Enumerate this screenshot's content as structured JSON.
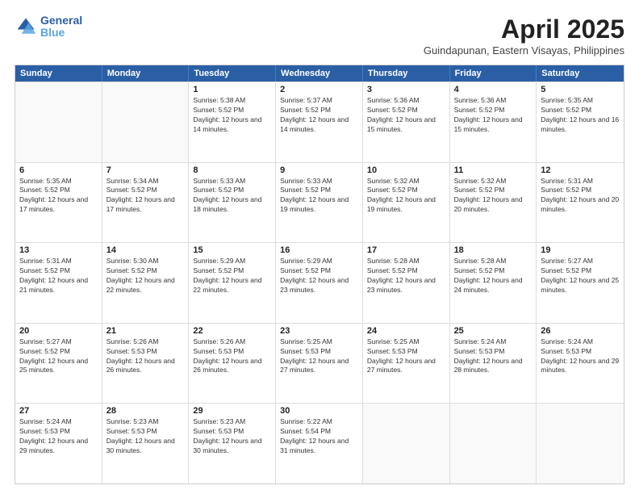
{
  "header": {
    "logo_line1": "General",
    "logo_line2": "Blue",
    "month": "April 2025",
    "location": "Guindapunan, Eastern Visayas, Philippines"
  },
  "weekdays": [
    "Sunday",
    "Monday",
    "Tuesday",
    "Wednesday",
    "Thursday",
    "Friday",
    "Saturday"
  ],
  "weeks": [
    [
      {
        "day": "",
        "sunrise": "",
        "sunset": "",
        "daylight": ""
      },
      {
        "day": "",
        "sunrise": "",
        "sunset": "",
        "daylight": ""
      },
      {
        "day": "1",
        "sunrise": "Sunrise: 5:38 AM",
        "sunset": "Sunset: 5:52 PM",
        "daylight": "Daylight: 12 hours and 14 minutes."
      },
      {
        "day": "2",
        "sunrise": "Sunrise: 5:37 AM",
        "sunset": "Sunset: 5:52 PM",
        "daylight": "Daylight: 12 hours and 14 minutes."
      },
      {
        "day": "3",
        "sunrise": "Sunrise: 5:36 AM",
        "sunset": "Sunset: 5:52 PM",
        "daylight": "Daylight: 12 hours and 15 minutes."
      },
      {
        "day": "4",
        "sunrise": "Sunrise: 5:36 AM",
        "sunset": "Sunset: 5:52 PM",
        "daylight": "Daylight: 12 hours and 15 minutes."
      },
      {
        "day": "5",
        "sunrise": "Sunrise: 5:35 AM",
        "sunset": "Sunset: 5:52 PM",
        "daylight": "Daylight: 12 hours and 16 minutes."
      }
    ],
    [
      {
        "day": "6",
        "sunrise": "Sunrise: 5:35 AM",
        "sunset": "Sunset: 5:52 PM",
        "daylight": "Daylight: 12 hours and 17 minutes."
      },
      {
        "day": "7",
        "sunrise": "Sunrise: 5:34 AM",
        "sunset": "Sunset: 5:52 PM",
        "daylight": "Daylight: 12 hours and 17 minutes."
      },
      {
        "day": "8",
        "sunrise": "Sunrise: 5:33 AM",
        "sunset": "Sunset: 5:52 PM",
        "daylight": "Daylight: 12 hours and 18 minutes."
      },
      {
        "day": "9",
        "sunrise": "Sunrise: 5:33 AM",
        "sunset": "Sunset: 5:52 PM",
        "daylight": "Daylight: 12 hours and 19 minutes."
      },
      {
        "day": "10",
        "sunrise": "Sunrise: 5:32 AM",
        "sunset": "Sunset: 5:52 PM",
        "daylight": "Daylight: 12 hours and 19 minutes."
      },
      {
        "day": "11",
        "sunrise": "Sunrise: 5:32 AM",
        "sunset": "Sunset: 5:52 PM",
        "daylight": "Daylight: 12 hours and 20 minutes."
      },
      {
        "day": "12",
        "sunrise": "Sunrise: 5:31 AM",
        "sunset": "Sunset: 5:52 PM",
        "daylight": "Daylight: 12 hours and 20 minutes."
      }
    ],
    [
      {
        "day": "13",
        "sunrise": "Sunrise: 5:31 AM",
        "sunset": "Sunset: 5:52 PM",
        "daylight": "Daylight: 12 hours and 21 minutes."
      },
      {
        "day": "14",
        "sunrise": "Sunrise: 5:30 AM",
        "sunset": "Sunset: 5:52 PM",
        "daylight": "Daylight: 12 hours and 22 minutes."
      },
      {
        "day": "15",
        "sunrise": "Sunrise: 5:29 AM",
        "sunset": "Sunset: 5:52 PM",
        "daylight": "Daylight: 12 hours and 22 minutes."
      },
      {
        "day": "16",
        "sunrise": "Sunrise: 5:29 AM",
        "sunset": "Sunset: 5:52 PM",
        "daylight": "Daylight: 12 hours and 23 minutes."
      },
      {
        "day": "17",
        "sunrise": "Sunrise: 5:28 AM",
        "sunset": "Sunset: 5:52 PM",
        "daylight": "Daylight: 12 hours and 23 minutes."
      },
      {
        "day": "18",
        "sunrise": "Sunrise: 5:28 AM",
        "sunset": "Sunset: 5:52 PM",
        "daylight": "Daylight: 12 hours and 24 minutes."
      },
      {
        "day": "19",
        "sunrise": "Sunrise: 5:27 AM",
        "sunset": "Sunset: 5:52 PM",
        "daylight": "Daylight: 12 hours and 25 minutes."
      }
    ],
    [
      {
        "day": "20",
        "sunrise": "Sunrise: 5:27 AM",
        "sunset": "Sunset: 5:52 PM",
        "daylight": "Daylight: 12 hours and 25 minutes."
      },
      {
        "day": "21",
        "sunrise": "Sunrise: 5:26 AM",
        "sunset": "Sunset: 5:53 PM",
        "daylight": "Daylight: 12 hours and 26 minutes."
      },
      {
        "day": "22",
        "sunrise": "Sunrise: 5:26 AM",
        "sunset": "Sunset: 5:53 PM",
        "daylight": "Daylight: 12 hours and 26 minutes."
      },
      {
        "day": "23",
        "sunrise": "Sunrise: 5:25 AM",
        "sunset": "Sunset: 5:53 PM",
        "daylight": "Daylight: 12 hours and 27 minutes."
      },
      {
        "day": "24",
        "sunrise": "Sunrise: 5:25 AM",
        "sunset": "Sunset: 5:53 PM",
        "daylight": "Daylight: 12 hours and 27 minutes."
      },
      {
        "day": "25",
        "sunrise": "Sunrise: 5:24 AM",
        "sunset": "Sunset: 5:53 PM",
        "daylight": "Daylight: 12 hours and 28 minutes."
      },
      {
        "day": "26",
        "sunrise": "Sunrise: 5:24 AM",
        "sunset": "Sunset: 5:53 PM",
        "daylight": "Daylight: 12 hours and 29 minutes."
      }
    ],
    [
      {
        "day": "27",
        "sunrise": "Sunrise: 5:24 AM",
        "sunset": "Sunset: 5:53 PM",
        "daylight": "Daylight: 12 hours and 29 minutes."
      },
      {
        "day": "28",
        "sunrise": "Sunrise: 5:23 AM",
        "sunset": "Sunset: 5:53 PM",
        "daylight": "Daylight: 12 hours and 30 minutes."
      },
      {
        "day": "29",
        "sunrise": "Sunrise: 5:23 AM",
        "sunset": "Sunset: 5:53 PM",
        "daylight": "Daylight: 12 hours and 30 minutes."
      },
      {
        "day": "30",
        "sunrise": "Sunrise: 5:22 AM",
        "sunset": "Sunset: 5:54 PM",
        "daylight": "Daylight: 12 hours and 31 minutes."
      },
      {
        "day": "",
        "sunrise": "",
        "sunset": "",
        "daylight": ""
      },
      {
        "day": "",
        "sunrise": "",
        "sunset": "",
        "daylight": ""
      },
      {
        "day": "",
        "sunrise": "",
        "sunset": "",
        "daylight": ""
      }
    ]
  ]
}
